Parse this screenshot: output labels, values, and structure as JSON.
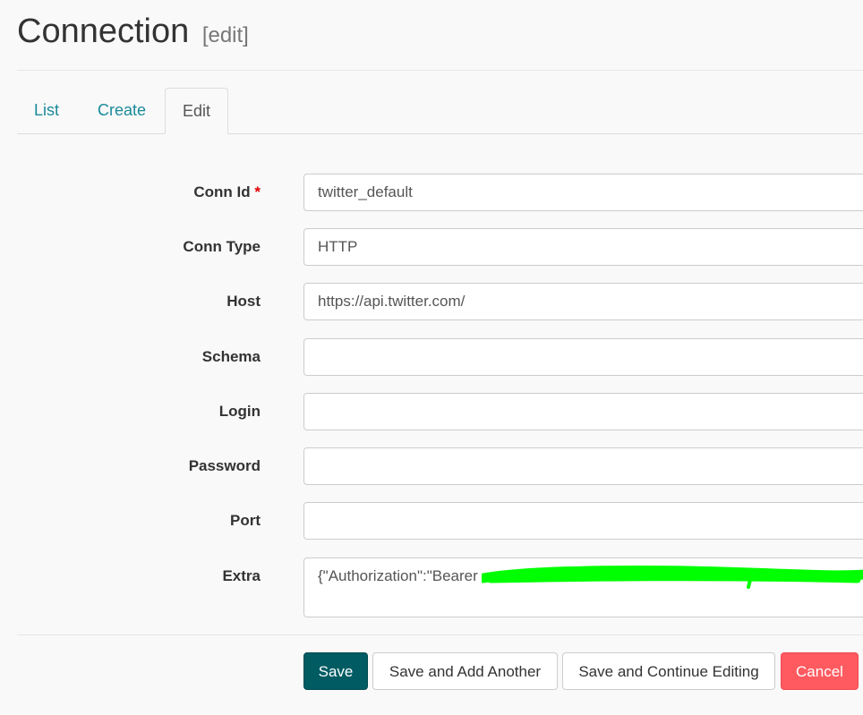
{
  "header": {
    "title": "Connection",
    "subtitle": "[edit]"
  },
  "tabs": [
    {
      "label": "List"
    },
    {
      "label": "Create"
    },
    {
      "label": "Edit",
      "active": true
    }
  ],
  "form": {
    "required_marker": "*",
    "fields": [
      {
        "label": "Conn Id",
        "value": "twitter_default",
        "required": true
      },
      {
        "label": "Conn Type",
        "value": "HTTP"
      },
      {
        "label": "Host",
        "value": "https://api.twitter.com/"
      },
      {
        "label": "Schema",
        "value": ""
      },
      {
        "label": "Login",
        "value": ""
      },
      {
        "label": "Password",
        "value": ""
      },
      {
        "label": "Port",
        "value": ""
      },
      {
        "label": "Extra",
        "value": "{\"Authorization\":\"Bearer"
      }
    ],
    "redaction_color": "#00ff00"
  },
  "buttons": {
    "save": "Save",
    "save_add": "Save and Add Another",
    "save_continue": "Save and Continue Editing",
    "cancel": "Cancel"
  },
  "colors": {
    "primary": "#005b63",
    "danger": "#fe5a5f",
    "link": "#1a8a9a"
  }
}
